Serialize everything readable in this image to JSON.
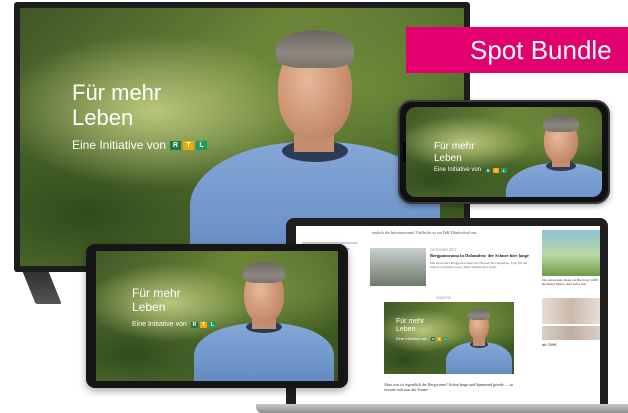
{
  "banner": {
    "label": "Spot Bundle",
    "color": "#e2006e"
  },
  "campaign": {
    "headline_line1": "Für mehr",
    "headline_line2": "Leben",
    "subline": "Eine Initiative von",
    "logo": [
      "R",
      "T",
      "L"
    ],
    "logo_colors": [
      "#1f7a4a",
      "#f2a900",
      "#1f9a63"
    ]
  },
  "laptop_site": {
    "teaser_top_left": "Nordsee. Mit Meerblick zwei Wochen Urlaub an den Küsten",
    "teaser_top_mid": "einfach die Informationen! Vielleicht so ein FüR Filmfestival aus",
    "article_title": "Bergpanorama in Dolomiten: der Schnee hier lange",
    "article_kicker": "OUTDOOR ZEIT",
    "article_body": "Die besonders Bergpanoramen im schönen Hochgebirge. Tipp für die Saison nochmals beste. Mehr Inhalte hier lesen.",
    "ad_label": "ANZEIGE",
    "bottom_text": "Aber was ist eigentlich der Bergwinter? Schon lange und Spannend gerade — so erwarte sich nun der Sonne",
    "side_caption": "Die entspannte Reise an Bord das Schiff Richtung Süden. Alle Infos hier",
    "side_price": "ab 299€"
  }
}
